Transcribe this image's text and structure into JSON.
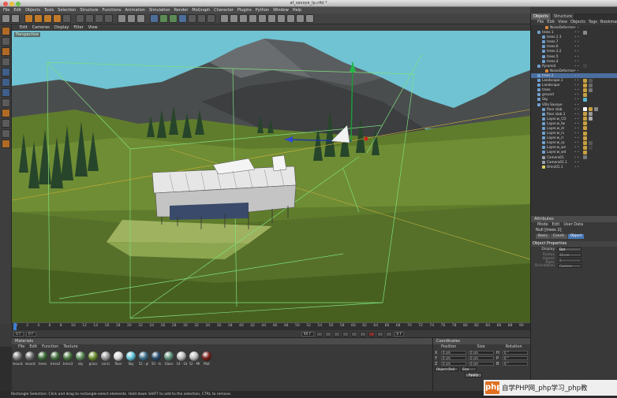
{
  "window": {
    "title": "af_savoye_lp.c4d *"
  },
  "menu": [
    "File",
    "Edit",
    "Objects",
    "Tools",
    "Selection",
    "Structure",
    "Functions",
    "Animation",
    "Simulation",
    "Render",
    "MoGraph",
    "Character",
    "Plugins",
    "Python",
    "Window",
    "Help"
  ],
  "viewport": {
    "menu": [
      "Edit",
      "Cameras",
      "Display",
      "Filter",
      "View"
    ],
    "camera_label": "Perspective"
  },
  "timeline": {
    "ticks": [
      "0",
      "2",
      "4",
      "6",
      "8",
      "10",
      "12",
      "14",
      "16",
      "18",
      "20",
      "22",
      "24",
      "26",
      "28",
      "30",
      "32",
      "34",
      "36",
      "38",
      "40",
      "42",
      "44",
      "46",
      "48",
      "50",
      "52",
      "54",
      "56",
      "58",
      "60",
      "62",
      "64",
      "66",
      "68",
      "70",
      "72",
      "74",
      "76",
      "78",
      "80",
      "82",
      "84",
      "86",
      "88",
      "90"
    ],
    "current_frame": "0 F",
    "start": "0 F",
    "end": "90 F",
    "fps": "0 F"
  },
  "materials": {
    "title": "Materials",
    "menu": [
      "File",
      "Edit",
      "Function",
      "Texture"
    ],
    "items": [
      {
        "label": "mounta",
        "color": "#7d7d7d"
      },
      {
        "label": "mounta",
        "color": "#6f6f6f"
      },
      {
        "label": "trees",
        "color": "#3d6e3a"
      },
      {
        "label": "trees2",
        "color": "#46703f"
      },
      {
        "label": "trees3",
        "color": "#4d7a45"
      },
      {
        "label": "sky",
        "color": "#5a8a57"
      },
      {
        "label": "grass",
        "color": "#6a8e2d"
      },
      {
        "label": "concr",
        "color": "#9a9a9a"
      },
      {
        "label": "floor",
        "color": "#d8d8d8"
      },
      {
        "label": "Sky",
        "color": "#61c3d8"
      },
      {
        "label": "52 - pi",
        "color": "#3f6f8a"
      },
      {
        "label": "50 - Is",
        "color": "#2a4d6e"
      },
      {
        "label": "Glass",
        "color": "#5f8f7a"
      },
      {
        "label": "14 - Gk",
        "color": "#b8b8b8"
      },
      {
        "label": "52 - Mt",
        "color": "#bdbdbd"
      },
      {
        "label": "Mat",
        "color": "#7a1f1a"
      }
    ]
  },
  "coordinates": {
    "title": "Coordinates",
    "headers": [
      "Position",
      "Size",
      "Rotation"
    ],
    "rows": [
      {
        "axis": "X",
        "pos": "0 cm",
        "size": "0 cm",
        "rot_axis": "H",
        "rot": "0 °"
      },
      {
        "axis": "Y",
        "pos": "0 cm",
        "size": "0 cm",
        "rot_axis": "P",
        "rot": "0 °"
      },
      {
        "axis": "Z",
        "pos": "0 cm",
        "size": "0 cm",
        "rot_axis": "B",
        "rot": "0 °"
      }
    ],
    "mode": "Object (Rel)",
    "size_mode": "Size",
    "apply": "Apply"
  },
  "status": "Rectangle Selection: Click and drag to rectangle-select elements. Hold down SHIFT to add to the selection, CTRL to remove.",
  "objects_panel": {
    "tabs": [
      "Objects",
      "Structure"
    ],
    "menu": [
      "File",
      "Edit",
      "View",
      "Objects",
      "Tags",
      "Bookmarks"
    ],
    "tree": [
      {
        "name": "NoiseDeformer",
        "indent": 18,
        "icon": "#d9873a",
        "sel": false,
        "tags": []
      },
      {
        "name": "trees 1",
        "indent": 8,
        "icon": "#6fa0d0",
        "sel": false,
        "tags": [
          "#8a8a8a"
        ]
      },
      {
        "name": "trees 2.3",
        "indent": 14,
        "icon": "#6fa0d0",
        "sel": false,
        "tags": []
      },
      {
        "name": "trees.7",
        "indent": 14,
        "icon": "#6fa0d0",
        "sel": false,
        "tags": []
      },
      {
        "name": "trees.6",
        "indent": 14,
        "icon": "#6fa0d0",
        "sel": false,
        "tags": []
      },
      {
        "name": "trees 2.2",
        "indent": 14,
        "icon": "#6fa0d0",
        "sel": false,
        "tags": []
      },
      {
        "name": "trees.5",
        "indent": 14,
        "icon": "#6fa0d0",
        "sel": false,
        "tags": []
      },
      {
        "name": "trees.4",
        "indent": 14,
        "icon": "#6fa0d0",
        "sel": false,
        "tags": []
      },
      {
        "name": "Pyramid",
        "indent": 8,
        "icon": "#6fa0d0",
        "sel": false,
        "tags": [
          "#444444"
        ]
      },
      {
        "name": "NoiseDeformer",
        "indent": 18,
        "icon": "#d9873a",
        "sel": false,
        "tags": []
      },
      {
        "name": "trees 2",
        "indent": 8,
        "icon": "#6fa0d0",
        "sel": true,
        "tags": []
      },
      {
        "name": "Landscape.1",
        "indent": 8,
        "icon": "#6fa0d0",
        "sel": false,
        "tags": [
          "#c9a040",
          "#555555"
        ]
      },
      {
        "name": "Landscape",
        "indent": 8,
        "icon": "#6fa0d0",
        "sel": false,
        "tags": [
          "#c9a040",
          "#666666"
        ]
      },
      {
        "name": "trees",
        "indent": 8,
        "icon": "#6fa0d0",
        "sel": false,
        "tags": [
          "#c9a040",
          "#777777"
        ]
      },
      {
        "name": "ground",
        "indent": 8,
        "icon": "#6fa0d0",
        "sel": false,
        "tags": [
          "#c9a040"
        ]
      },
      {
        "name": "Sky",
        "indent": 8,
        "icon": "#6fa0d0",
        "sel": false,
        "tags": [
          "#5ab7d0"
        ]
      },
      {
        "name": "Villa Savoye",
        "indent": 8,
        "icon": "#6fa0d0",
        "sel": false,
        "tags": []
      },
      {
        "name": "floor slab",
        "indent": 14,
        "icon": "#6fa0d0",
        "sel": false,
        "tags": [
          "#ffffff",
          "#c9a040",
          "#888888"
        ]
      },
      {
        "name": "floor slab.1",
        "indent": 14,
        "icon": "#6fa0d0",
        "sel": false,
        "tags": [
          "#c9a040",
          "#999999"
        ]
      },
      {
        "name": "Layer.w_CO",
        "indent": 14,
        "icon": "#6fa0d0",
        "sel": false,
        "tags": [
          "#c9a040",
          "#aaaaaa"
        ]
      },
      {
        "name": "Layer.w_fw",
        "indent": 14,
        "icon": "#6fa0d0",
        "sel": false,
        "tags": [
          "#c9a040"
        ]
      },
      {
        "name": "Layer.w_st",
        "indent": 14,
        "icon": "#6fa0d0",
        "sel": false,
        "tags": [
          "#c9a040"
        ]
      },
      {
        "name": "Layer.w_rs",
        "indent": 14,
        "icon": "#6fa0d0",
        "sel": false,
        "tags": [
          "#c9a040"
        ]
      },
      {
        "name": "Layer.w_rl",
        "indent": 14,
        "icon": "#6fa0d0",
        "sel": false,
        "tags": [
          "#c9a040"
        ]
      },
      {
        "name": "Layer.w_rp",
        "indent": 14,
        "icon": "#6fa0d0",
        "sel": false,
        "tags": [
          "#c9a040",
          "#555555"
        ]
      },
      {
        "name": "Layer.w_wn",
        "indent": 14,
        "icon": "#6fa0d0",
        "sel": false,
        "tags": [
          "#c9a040",
          "#444444"
        ]
      },
      {
        "name": "Layer.w_wd",
        "indent": 14,
        "icon": "#6fa0d0",
        "sel": false,
        "tags": [
          "#c9a040",
          "#333333"
        ]
      },
      {
        "name": "Camera01",
        "indent": 14,
        "icon": "#9aa4b0",
        "sel": false,
        "tags": [
          "#777777"
        ]
      },
      {
        "name": "Camera01.1",
        "indent": 14,
        "icon": "#9aa4b0",
        "sel": false,
        "tags": []
      },
      {
        "name": "Omni01.1",
        "indent": 14,
        "icon": "#e0d060",
        "sel": false,
        "tags": []
      }
    ]
  },
  "attributes": {
    "title": "Attributes",
    "menu": [
      "Mode",
      "Edit",
      "User Data"
    ],
    "object_name": "Null [trees 2]",
    "tabs": [
      "Basic",
      "Coord.",
      "Object"
    ],
    "section": "Object Properties",
    "props": [
      {
        "label": "Display",
        "value": "Dot",
        "dim": false
      },
      {
        "label": "Radius",
        "value": "10 cm",
        "dim": true
      },
      {
        "label": "Aspect Ratio",
        "value": "1",
        "dim": true
      },
      {
        "label": "Orientation",
        "value": "Camera",
        "dim": true
      }
    ]
  },
  "watermark": {
    "logo": "php",
    "text": "自学PHP网_php学习_php教"
  },
  "colors": {
    "sky": "#6fc3d2",
    "grass": "#6a8a30",
    "accent": "#4a78b5"
  }
}
